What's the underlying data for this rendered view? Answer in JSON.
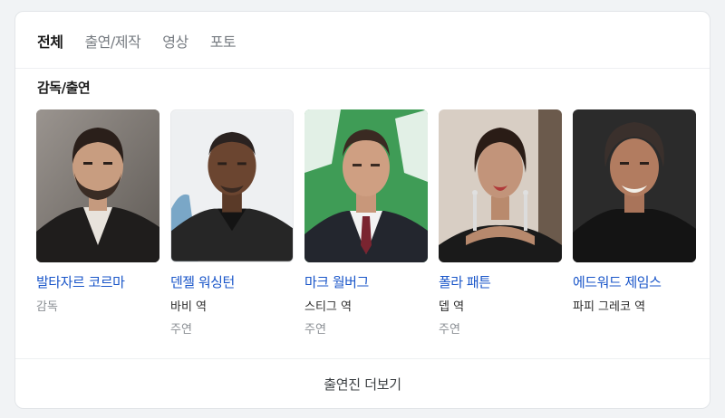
{
  "tabs": [
    {
      "label": "전체",
      "active": true
    },
    {
      "label": "출연/제작",
      "active": false
    },
    {
      "label": "영상",
      "active": false
    },
    {
      "label": "포토",
      "active": false
    }
  ],
  "section_title": "감독/출연",
  "people": [
    {
      "name": "발타자르 코르마",
      "role": "감독",
      "sub": ""
    },
    {
      "name": "덴젤 워싱턴",
      "role": "바비 역",
      "sub": "주연"
    },
    {
      "name": "마크 월버그",
      "role": "스티그 역",
      "sub": "주연"
    },
    {
      "name": "폴라 패튼",
      "role": "뎁 역",
      "sub": "주연"
    },
    {
      "name": "에드워드 제임스",
      "role": "파피 그레코 역",
      "sub": ""
    }
  ],
  "photo_backgrounds": [
    "#8a8580",
    "#eef0f2",
    "#3e9a54",
    "#d9cfc6",
    "#2a2a2a"
  ],
  "more_label": "출연진 더보기",
  "colors": {
    "link": "#1a56c9",
    "muted": "#8b8f94",
    "active_tab": "#1a1a1a"
  }
}
